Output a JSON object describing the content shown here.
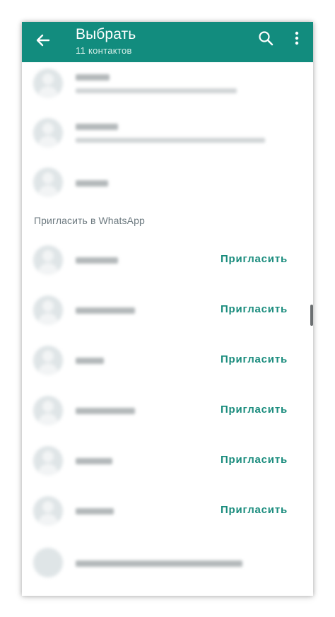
{
  "header": {
    "title": "Выбрать",
    "subtitle": "11 контактов"
  },
  "icons": {
    "back": "back-arrow-icon",
    "search": "search-icon",
    "more": "more-vert-icon"
  },
  "sections": {
    "invite_title": "Пригласить в WhatsApp"
  },
  "invite_rows": [
    {
      "action_label": "Пригласить"
    },
    {
      "action_label": "Пригласить"
    },
    {
      "action_label": "Пригласить"
    },
    {
      "action_label": "Пригласить"
    },
    {
      "action_label": "Пригласить"
    },
    {
      "action_label": "Пригласить"
    }
  ],
  "colors": {
    "appbar": "#128c7e",
    "accent": "#1a8c7d"
  }
}
